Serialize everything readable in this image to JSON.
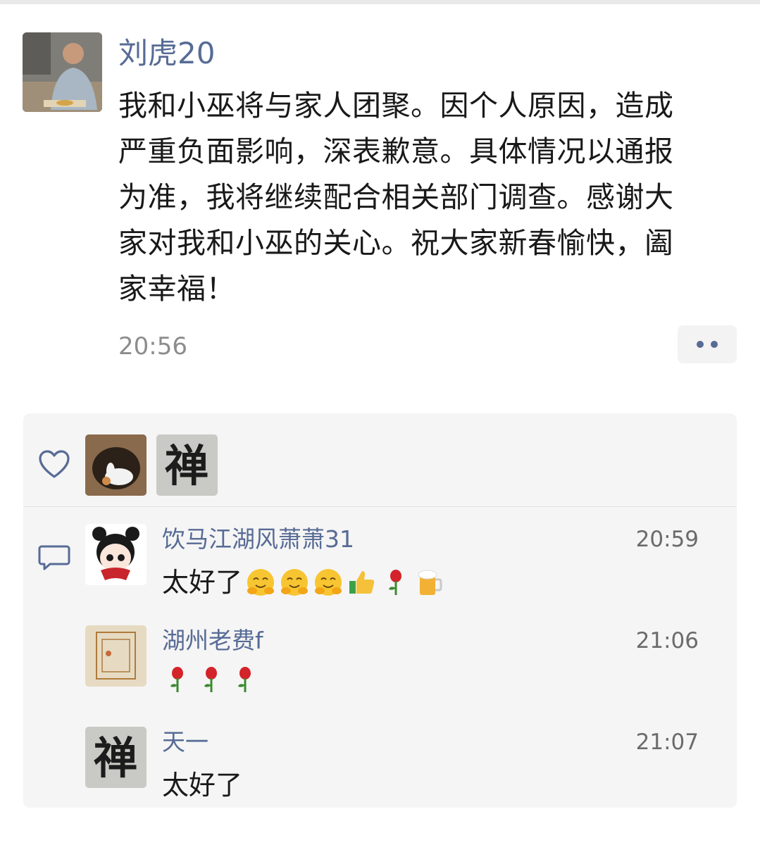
{
  "post": {
    "author": "刘虎20",
    "lines": [
      "我和小巫将与家人团聚。因个人原因，造成",
      "严重负面影响，深表歉意。具体情况以通报",
      "为准，我将继续配合相关部门调查。感谢大",
      "家对我和小巫的关心。祝大家新春愉快，阖",
      "家幸福！"
    ],
    "time": "20:56",
    "more_icon": "more-dots-icon"
  },
  "likes": {
    "icon": "heart-icon",
    "avatars": [
      "rabbit-in-hole-avatar",
      "chan-calligraphy-avatar"
    ]
  },
  "comments_icon": "comment-bubble-icon",
  "comments": [
    {
      "name": "饮马江湖风萧萧31",
      "time": "20:59",
      "text": "太好了",
      "emojis": [
        "hug-emoji",
        "hug-emoji",
        "hug-emoji",
        "thumbs-up-emoji",
        "rose-emoji",
        "beer-emoji"
      ]
    },
    {
      "name": "湖州老费f",
      "time": "21:06",
      "text": "",
      "emojis": [
        "rose-emoji",
        "rose-emoji",
        "rose-emoji"
      ]
    },
    {
      "name": "天一",
      "time": "21:07",
      "text": "太好了",
      "emojis": []
    }
  ],
  "colors": {
    "link": "#576b95",
    "panel": "#f5f5f5",
    "text": "#191919",
    "meta": "#8c8c8c"
  }
}
